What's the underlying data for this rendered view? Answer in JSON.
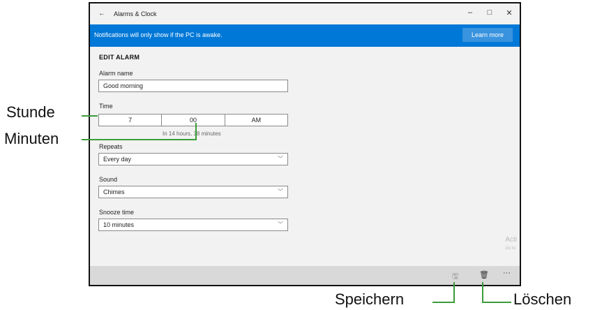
{
  "window": {
    "title": "Alarms & Clock",
    "back_icon": "←",
    "minimize": "–",
    "maximize": "□",
    "close": "✕"
  },
  "banner": {
    "message": "Notifications will only show if the PC is awake.",
    "learn_more": "Learn more"
  },
  "edit": {
    "heading": "EDIT ALARM",
    "alarm_name_label": "Alarm name",
    "alarm_name_value": "Good morning",
    "time_label": "Time",
    "hour": "7",
    "minutes": "00",
    "ampm": "AM",
    "time_hint": "In 14 hours, 38 minutes",
    "repeats_label": "Repeats",
    "repeats_value": "Every day",
    "sound_label": "Sound",
    "sound_value": "Chimes",
    "snooze_label": "Snooze time",
    "snooze_value": "10 minutes"
  },
  "cmdbar": {
    "save_icon": "🖫",
    "delete_icon": "🗑",
    "more_icon": "···"
  },
  "watermark": {
    "line1": "Acti",
    "line2": "Go to"
  },
  "callouts": {
    "stunde": "Stunde",
    "minuten": "Minuten",
    "speichern": "Speichern",
    "loeschen": "Löschen"
  },
  "colors": {
    "accent": "#0078d7",
    "callout_line": "#3a9c3a"
  }
}
